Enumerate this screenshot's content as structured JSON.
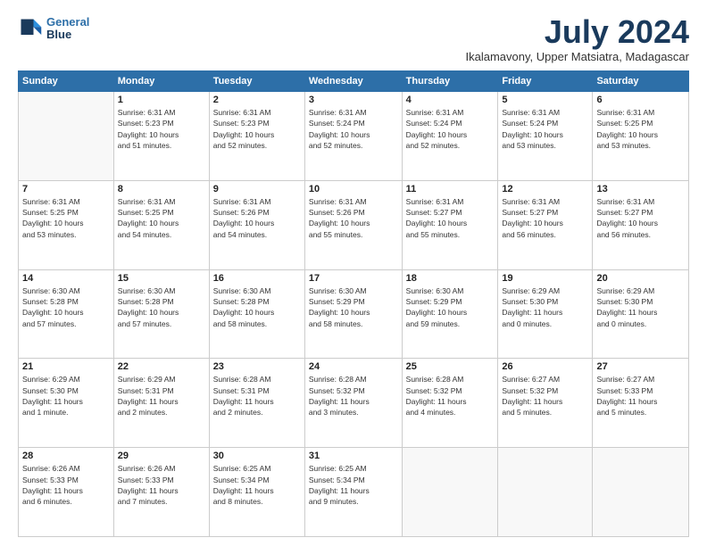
{
  "header": {
    "logo_line1": "General",
    "logo_line2": "Blue",
    "month": "July 2024",
    "location": "Ikalamavony, Upper Matsiatra, Madagascar"
  },
  "weekdays": [
    "Sunday",
    "Monday",
    "Tuesday",
    "Wednesday",
    "Thursday",
    "Friday",
    "Saturday"
  ],
  "weeks": [
    [
      {
        "day": "",
        "info": ""
      },
      {
        "day": "1",
        "info": "Sunrise: 6:31 AM\nSunset: 5:23 PM\nDaylight: 10 hours\nand 51 minutes."
      },
      {
        "day": "2",
        "info": "Sunrise: 6:31 AM\nSunset: 5:23 PM\nDaylight: 10 hours\nand 52 minutes."
      },
      {
        "day": "3",
        "info": "Sunrise: 6:31 AM\nSunset: 5:24 PM\nDaylight: 10 hours\nand 52 minutes."
      },
      {
        "day": "4",
        "info": "Sunrise: 6:31 AM\nSunset: 5:24 PM\nDaylight: 10 hours\nand 52 minutes."
      },
      {
        "day": "5",
        "info": "Sunrise: 6:31 AM\nSunset: 5:24 PM\nDaylight: 10 hours\nand 53 minutes."
      },
      {
        "day": "6",
        "info": "Sunrise: 6:31 AM\nSunset: 5:25 PM\nDaylight: 10 hours\nand 53 minutes."
      }
    ],
    [
      {
        "day": "7",
        "info": "Sunrise: 6:31 AM\nSunset: 5:25 PM\nDaylight: 10 hours\nand 53 minutes."
      },
      {
        "day": "8",
        "info": "Sunrise: 6:31 AM\nSunset: 5:25 PM\nDaylight: 10 hours\nand 54 minutes."
      },
      {
        "day": "9",
        "info": "Sunrise: 6:31 AM\nSunset: 5:26 PM\nDaylight: 10 hours\nand 54 minutes."
      },
      {
        "day": "10",
        "info": "Sunrise: 6:31 AM\nSunset: 5:26 PM\nDaylight: 10 hours\nand 55 minutes."
      },
      {
        "day": "11",
        "info": "Sunrise: 6:31 AM\nSunset: 5:27 PM\nDaylight: 10 hours\nand 55 minutes."
      },
      {
        "day": "12",
        "info": "Sunrise: 6:31 AM\nSunset: 5:27 PM\nDaylight: 10 hours\nand 56 minutes."
      },
      {
        "day": "13",
        "info": "Sunrise: 6:31 AM\nSunset: 5:27 PM\nDaylight: 10 hours\nand 56 minutes."
      }
    ],
    [
      {
        "day": "14",
        "info": "Sunrise: 6:30 AM\nSunset: 5:28 PM\nDaylight: 10 hours\nand 57 minutes."
      },
      {
        "day": "15",
        "info": "Sunrise: 6:30 AM\nSunset: 5:28 PM\nDaylight: 10 hours\nand 57 minutes."
      },
      {
        "day": "16",
        "info": "Sunrise: 6:30 AM\nSunset: 5:28 PM\nDaylight: 10 hours\nand 58 minutes."
      },
      {
        "day": "17",
        "info": "Sunrise: 6:30 AM\nSunset: 5:29 PM\nDaylight: 10 hours\nand 58 minutes."
      },
      {
        "day": "18",
        "info": "Sunrise: 6:30 AM\nSunset: 5:29 PM\nDaylight: 10 hours\nand 59 minutes."
      },
      {
        "day": "19",
        "info": "Sunrise: 6:29 AM\nSunset: 5:30 PM\nDaylight: 11 hours\nand 0 minutes."
      },
      {
        "day": "20",
        "info": "Sunrise: 6:29 AM\nSunset: 5:30 PM\nDaylight: 11 hours\nand 0 minutes."
      }
    ],
    [
      {
        "day": "21",
        "info": "Sunrise: 6:29 AM\nSunset: 5:30 PM\nDaylight: 11 hours\nand 1 minute."
      },
      {
        "day": "22",
        "info": "Sunrise: 6:29 AM\nSunset: 5:31 PM\nDaylight: 11 hours\nand 2 minutes."
      },
      {
        "day": "23",
        "info": "Sunrise: 6:28 AM\nSunset: 5:31 PM\nDaylight: 11 hours\nand 2 minutes."
      },
      {
        "day": "24",
        "info": "Sunrise: 6:28 AM\nSunset: 5:32 PM\nDaylight: 11 hours\nand 3 minutes."
      },
      {
        "day": "25",
        "info": "Sunrise: 6:28 AM\nSunset: 5:32 PM\nDaylight: 11 hours\nand 4 minutes."
      },
      {
        "day": "26",
        "info": "Sunrise: 6:27 AM\nSunset: 5:32 PM\nDaylight: 11 hours\nand 5 minutes."
      },
      {
        "day": "27",
        "info": "Sunrise: 6:27 AM\nSunset: 5:33 PM\nDaylight: 11 hours\nand 5 minutes."
      }
    ],
    [
      {
        "day": "28",
        "info": "Sunrise: 6:26 AM\nSunset: 5:33 PM\nDaylight: 11 hours\nand 6 minutes."
      },
      {
        "day": "29",
        "info": "Sunrise: 6:26 AM\nSunset: 5:33 PM\nDaylight: 11 hours\nand 7 minutes."
      },
      {
        "day": "30",
        "info": "Sunrise: 6:25 AM\nSunset: 5:34 PM\nDaylight: 11 hours\nand 8 minutes."
      },
      {
        "day": "31",
        "info": "Sunrise: 6:25 AM\nSunset: 5:34 PM\nDaylight: 11 hours\nand 9 minutes."
      },
      {
        "day": "",
        "info": ""
      },
      {
        "day": "",
        "info": ""
      },
      {
        "day": "",
        "info": ""
      }
    ]
  ]
}
